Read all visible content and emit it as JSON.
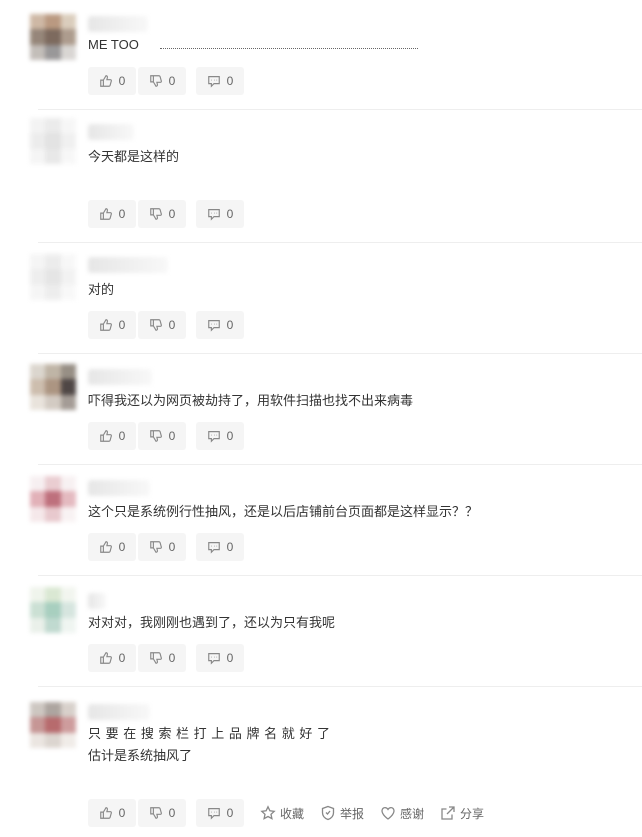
{
  "comments": [
    {
      "text": "ME TOO",
      "actions": {
        "like": "0",
        "dislike": "0",
        "reply": "0"
      }
    },
    {
      "text": "今天都是这样的",
      "actions": {
        "like": "0",
        "dislike": "0",
        "reply": "0"
      }
    },
    {
      "text": "对的",
      "actions": {
        "like": "0",
        "dislike": "0",
        "reply": "0"
      }
    },
    {
      "text": "吓得我还以为网页被劫持了，用软件扫描也找不出来病毒",
      "actions": {
        "like": "0",
        "dislike": "0",
        "reply": "0"
      }
    },
    {
      "text": "这个只是系统例行性抽风，还是以后店铺前台页面都是这样显示？？",
      "actions": {
        "like": "0",
        "dislike": "0",
        "reply": "0"
      }
    },
    {
      "text": "对对对，我刚刚也遇到了，还以为只有我呢",
      "actions": {
        "like": "0",
        "dislike": "0",
        "reply": "0"
      }
    },
    {
      "text_line1": "只 要 在 搜 索 栏 打 上 品 牌 名 就 好 了",
      "text_line2": "估计是系统抽风了",
      "actions": {
        "like": "0",
        "dislike": "0",
        "reply": "0"
      },
      "extra_actions": {
        "favorite": "收藏",
        "report": "举报",
        "thanks": "感谢",
        "share": "分享"
      }
    }
  ],
  "icons": [
    "thumbs-up-icon",
    "thumbs-down-icon",
    "comment-icon",
    "star-icon",
    "shield-icon",
    "heart-icon",
    "share-icon"
  ]
}
